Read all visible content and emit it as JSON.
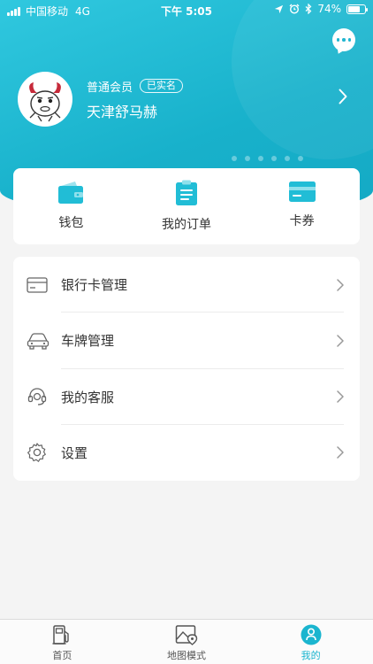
{
  "status_bar": {
    "carrier": "中国移动",
    "network": "4G",
    "time": "下午 5:05",
    "battery": "74%",
    "battery_level": 0.74
  },
  "profile": {
    "member_level": "普通会员",
    "verified_badge": "已实名",
    "username": "天津舒马赫"
  },
  "quick_actions": [
    {
      "label": "钱包",
      "icon": "wallet-icon"
    },
    {
      "label": "我的订单",
      "icon": "order-clipboard-icon"
    },
    {
      "label": "卡券",
      "icon": "coupon-card-icon"
    }
  ],
  "menu": [
    {
      "label": "银行卡管理",
      "icon": "bank-card-icon"
    },
    {
      "label": "车牌管理",
      "icon": "car-icon"
    },
    {
      "label": "我的客服",
      "icon": "customer-service-icon"
    },
    {
      "label": "设置",
      "icon": "settings-gear-icon"
    }
  ],
  "bottom_nav": [
    {
      "label": "首页",
      "icon": "gas-pump-icon",
      "active": false
    },
    {
      "label": "地图模式",
      "icon": "map-pin-icon",
      "active": false
    },
    {
      "label": "我的",
      "icon": "profile-icon",
      "active": true
    }
  ],
  "colors": {
    "brand": "#1bb5cf",
    "header_gradient_start": "#30c8df",
    "header_gradient_end": "#14a9c4",
    "text_primary": "#333333"
  }
}
